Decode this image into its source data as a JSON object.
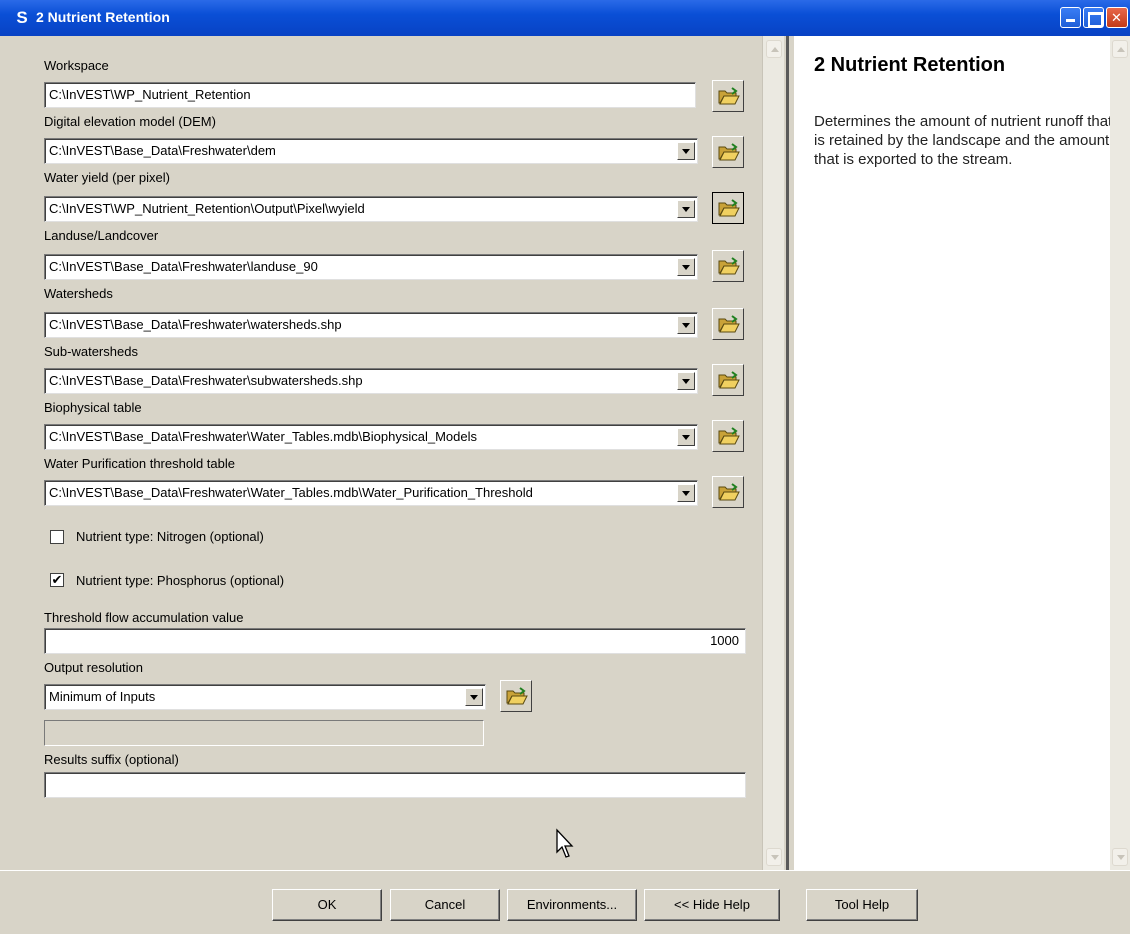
{
  "window": {
    "title": "2 Nutrient Retention"
  },
  "form": {
    "workspace": {
      "label": "Workspace",
      "value": "C:\\InVEST\\WP_Nutrient_Retention"
    },
    "dem": {
      "label": "Digital elevation model (DEM)",
      "value": "C:\\InVEST\\Base_Data\\Freshwater\\dem"
    },
    "water_yield": {
      "label": "Water yield (per pixel)",
      "value": "C:\\InVEST\\WP_Nutrient_Retention\\Output\\Pixel\\wyield"
    },
    "landuse": {
      "label": "Landuse/Landcover",
      "value": "C:\\InVEST\\Base_Data\\Freshwater\\landuse_90"
    },
    "watersheds": {
      "label": "Watersheds",
      "value": "C:\\InVEST\\Base_Data\\Freshwater\\watersheds.shp"
    },
    "subwatersheds": {
      "label": "Sub-watersheds",
      "value": "C:\\InVEST\\Base_Data\\Freshwater\\subwatersheds.shp"
    },
    "biophysical": {
      "label": "Biophysical table",
      "value": "C:\\InVEST\\Base_Data\\Freshwater\\Water_Tables.mdb\\Biophysical_Models"
    },
    "threshold_table": {
      "label": "Water Purification threshold table",
      "value": "C:\\InVEST\\Base_Data\\Freshwater\\Water_Tables.mdb\\Water_Purification_Threshold"
    },
    "nitrogen": {
      "label": "Nutrient type: Nitrogen (optional)",
      "checked": false,
      "mark": ""
    },
    "phosphorus": {
      "label": "Nutrient type: Phosphorus (optional)",
      "checked": true,
      "mark": "✔"
    },
    "flow_threshold": {
      "label": "Threshold flow accumulation value",
      "value": "1000"
    },
    "output_resolution": {
      "label": "Output resolution",
      "value": "Minimum of Inputs"
    },
    "results_suffix": {
      "label": "Results suffix (optional)",
      "value": ""
    }
  },
  "help": {
    "title": "2 Nutrient Retention",
    "body": "Determines the amount of nutrient runoff that is retained by the landscape and the amount that is exported to the stream."
  },
  "buttons": {
    "ok": "OK",
    "cancel": "Cancel",
    "environments": "Environments...",
    "hide_help": "<< Hide Help",
    "tool_help": "Tool Help"
  },
  "colors": {
    "titlebar": "#0a4fd6",
    "dialog": "#d8d4c8",
    "help_bg": "#ffffff"
  },
  "icons": [
    "app-icon",
    "folder-open-icon",
    "dropdown-arrow-icon",
    "mouse-cursor-icon"
  ]
}
